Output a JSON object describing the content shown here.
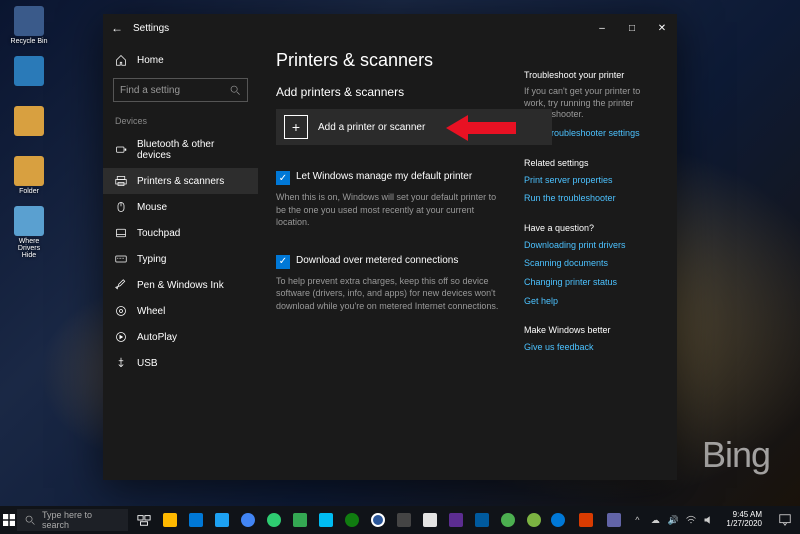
{
  "window": {
    "title": "Settings",
    "page_title": "Printers & scanners",
    "search_placeholder": "Find a setting",
    "category": "Devices",
    "home_label": "Home"
  },
  "sidebar": {
    "items": [
      {
        "label": "Bluetooth & other devices",
        "selected": false
      },
      {
        "label": "Printers & scanners",
        "selected": true
      },
      {
        "label": "Mouse",
        "selected": false
      },
      {
        "label": "Touchpad",
        "selected": false
      },
      {
        "label": "Typing",
        "selected": false
      },
      {
        "label": "Pen & Windows Ink",
        "selected": false
      },
      {
        "label": "Wheel",
        "selected": false
      },
      {
        "label": "AutoPlay",
        "selected": false
      },
      {
        "label": "USB",
        "selected": false
      }
    ]
  },
  "content": {
    "section1_title": "Add printers & scanners",
    "add_button": "Add a printer or scanner",
    "chk1_label": "Let Windows manage my default printer",
    "chk1_desc": "When this is on, Windows will set your default printer to be the one you used most recently at your current location.",
    "chk2_label": "Download over metered connections",
    "chk2_desc": "To help prevent extra charges, keep this off so device software (drivers, info, and apps) for new devices won't download while you're on metered Internet connections."
  },
  "rail": {
    "troubleshoot_h": "Troubleshoot your printer",
    "troubleshoot_p": "If you can't get your printer to work, try running the printer troubleshooter.",
    "troubleshoot_link": "Open troubleshooter settings",
    "related_h": "Related settings",
    "related_links": [
      "Print server properties",
      "Run the troubleshooter"
    ],
    "question_h": "Have a question?",
    "question_links": [
      "Downloading print drivers",
      "Scanning documents",
      "Changing printer status",
      "Get help"
    ],
    "better_h": "Make Windows better",
    "better_link": "Give us feedback"
  },
  "desktop": {
    "icons": [
      {
        "label": "Recycle Bin",
        "color": "#3a5a8a"
      },
      {
        "label": "",
        "color": "#2a7ab8"
      },
      {
        "label": "",
        "color": "#d8a040"
      },
      {
        "label": "Folder",
        "color": "#d8a040"
      },
      {
        "label": "Where Drivers Hide",
        "color": "#5aa0d0"
      }
    ],
    "watermark": "Bing"
  },
  "taskbar": {
    "search_placeholder": "Type here to search",
    "time": "9:45 AM",
    "date": "1/27/2020"
  },
  "colors": {
    "accent": "#0078d7",
    "link": "#4cc2ff",
    "arrow": "#e81123"
  }
}
